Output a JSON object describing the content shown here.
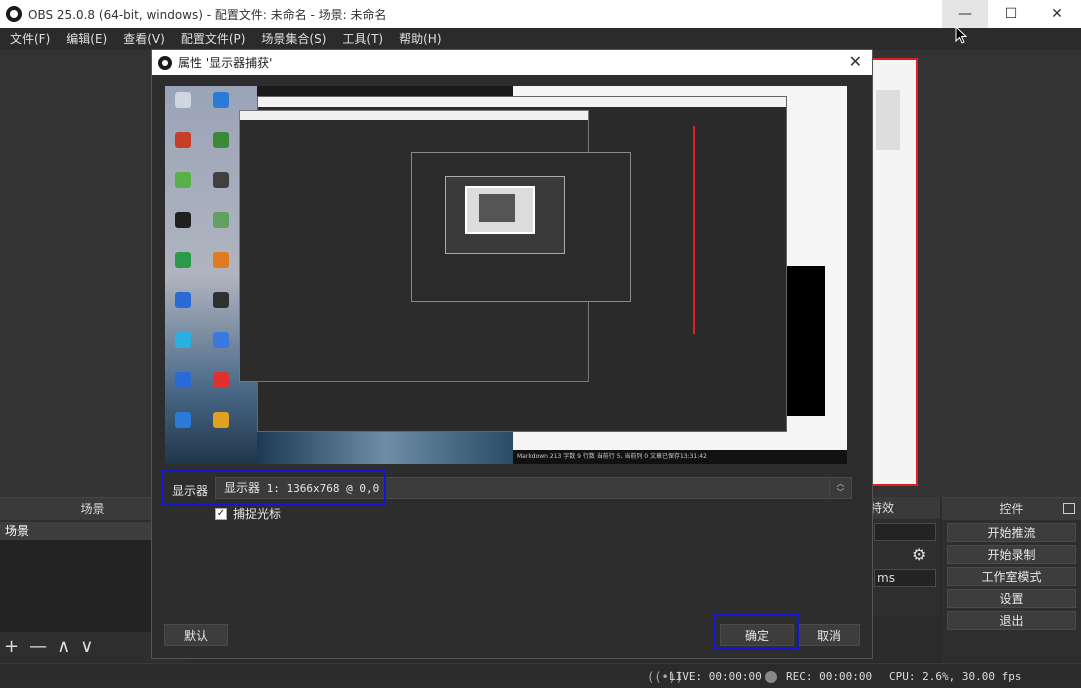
{
  "window": {
    "title": "OBS 25.0.8 (64-bit, windows) - 配置文件: 未命名 - 场景: 未命名",
    "min_glyph": "—",
    "max_glyph": "☐",
    "close_glyph": "✕"
  },
  "menu": [
    "文件(F)",
    "编辑(E)",
    "查看(V)",
    "配置文件(P)",
    "场景集合(S)",
    "工具(T)",
    "帮助(H)"
  ],
  "docks": {
    "scenes": {
      "header": "场景",
      "items": [
        "场景"
      ],
      "tools": [
        "+",
        "—",
        "∧",
        "∨"
      ]
    },
    "mixer": {
      "header_fragment": "特效",
      "ms_value": "ms"
    },
    "controls": {
      "header": "控件",
      "buttons": [
        "开始推流",
        "开始录制",
        "工作室模式",
        "设置",
        "退出"
      ]
    }
  },
  "status": {
    "live": "LIVE: 00:00:00",
    "rec": "REC: 00:00:00",
    "cpu": "CPU: 2.6%, 30.00 fps"
  },
  "dialog": {
    "title": "属性 '显示器捕获'",
    "close_glyph": "✕",
    "display_label": "显示器",
    "display_value_cn": "显示器",
    "display_value_rest": " 1: 1366x768 @ 0,0",
    "capture_cursor_label": "捕捉光标",
    "capture_cursor_checked": true,
    "defaults_button": "默认",
    "ok_button": "确定",
    "cancel_button": "取消",
    "preview_status": "Markdown  213 字数  9 行数  当前行 5, 当前列 0  文章已保存13:31:42"
  },
  "colors": {
    "highlight": "#1515d6",
    "source_outline": "#e02020",
    "panel": "#2e2e2e"
  }
}
